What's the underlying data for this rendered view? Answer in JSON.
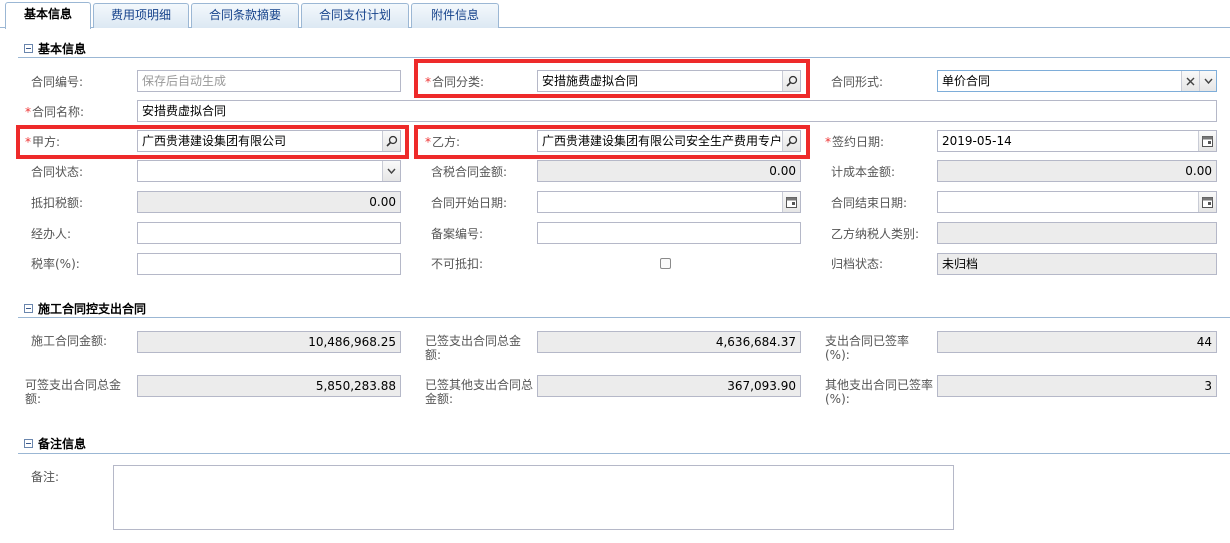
{
  "tabs": [
    {
      "label": "基本信息",
      "active": true
    },
    {
      "label": "费用项明细"
    },
    {
      "label": "合同条款摘要"
    },
    {
      "label": "合同支付计划"
    },
    {
      "label": "附件信息"
    }
  ],
  "sections": {
    "basic": "基本信息",
    "construction": "施工合同控支出合同",
    "remarks": "备注信息"
  },
  "basic": {
    "contract_no_label": "合同编号:",
    "contract_no_placeholder": "保存后自动生成",
    "category_label": "合同分类:",
    "category_value": "安措施费虚拟合同",
    "form_label": "合同形式:",
    "form_value": "单价合同",
    "name_label": "合同名称:",
    "name_value": "安措费虚拟合同",
    "party_a_label": "甲方:",
    "party_a_value": "广西贵港建设集团有限公司",
    "party_b_label": "乙方:",
    "party_b_value": "广西贵港建设集团有限公司安全生产费用专户",
    "sign_date_label": "签约日期:",
    "sign_date_value": "2019-05-14",
    "status_label": "合同状态:",
    "status_value": "",
    "tax_amount_label": "含税合同金额:",
    "tax_amount_value": "0.00",
    "cost_amount_label": "计成本金额:",
    "cost_amount_value": "0.00",
    "deduct_tax_label": "抵扣税额:",
    "deduct_tax_value": "0.00",
    "start_date_label": "合同开始日期:",
    "start_date_value": "",
    "end_date_label": "合同结束日期:",
    "end_date_value": "",
    "handler_label": "经办人:",
    "handler_value": "",
    "record_no_label": "备案编号:",
    "record_no_value": "",
    "taxpayer_type_label": "乙方纳税人类别:",
    "taxpayer_type_value": "",
    "tax_rate_label": "税率(%):",
    "tax_rate_value": "",
    "non_deductible_label": "不可抵扣:",
    "archive_label": "归档状态:",
    "archive_value": "未归档"
  },
  "construction": {
    "contract_amount_label": "施工合同金额:",
    "contract_amount_value": "10,486,968.25",
    "signed_total_label": "已签支出合同总金额:",
    "signed_total_value": "4,636,684.37",
    "signed_rate_label": "支出合同已签率(%):",
    "signed_rate_value": "44",
    "available_total_label": "可签支出合同总金额:",
    "available_total_value": "5,850,283.88",
    "other_signed_total_label": "已签其他支出合同总金额:",
    "other_signed_total_value": "367,093.90",
    "other_signed_rate_label": "其他支出合同已签率(%):",
    "other_signed_rate_value": "3"
  },
  "remarks": {
    "note_label": "备注:",
    "note_value": ""
  },
  "required_mark": "*",
  "colors": {
    "highlight": "#ee2a2a",
    "tab_text": "#15428b",
    "border": "#b5b8c8",
    "readonly_bg": "#ececec"
  }
}
